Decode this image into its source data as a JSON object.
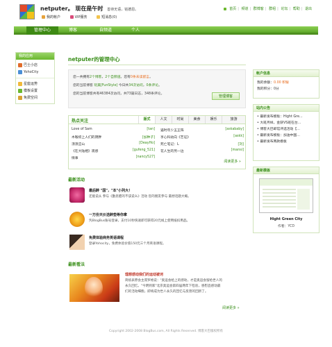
{
  "header": {
    "site_name": "netputer。",
    "status": "现在是午时",
    "slogan": "善待无语，铭德恩。",
    "user_links": [
      "我的帐户",
      "VIP服务",
      "短消息(0)"
    ],
    "top_nav": [
      "首页",
      "频道",
      "群博客",
      "群组",
      "论坛",
      "帮助",
      "退出"
    ]
  },
  "navbar": {
    "tabs": [
      "管理中心",
      "博客",
      "自频道",
      "个人"
    ]
  },
  "left": {
    "head": "我的应用",
    "group1": [
      "巴士小店",
      "YohoCity"
    ],
    "group2": [
      "星座运势",
      "模板设置",
      "免费空间"
    ]
  },
  "center": {
    "title": "netputer的管理中心",
    "stats": {
      "line1_a": "您一共拥有",
      "line1_b": "2个博客",
      "line1_c": "，",
      "line1_d": "2个自频道",
      "line1_e": "。您有",
      "line1_f": "0条未读留言",
      "line1_g": "。",
      "line2": "您的当前博客",
      "line2_blog": "玩美[FunStyle]",
      "line2_rest": "今日共",
      "line2_visits": "34次访问",
      "line2_end": "，",
      "line2_comments": "0条评论",
      "line2_tail": "。",
      "line3": "您的当前博客共有46384次访问，共73篇日志，348条评论。",
      "manage_btn": "管理博客"
    },
    "hot": {
      "title": "热点关注",
      "tabs": [
        "版式",
        "人文",
        "时尚",
        "美食",
        "娱乐",
        "旅游"
      ],
      "left_rows": [
        {
          "t": "Love of Sam",
          "a": "[tan]"
        },
        {
          "t": "木喉综上人们的阴胖",
          "a": "[加种子]"
        },
        {
          "t": "须须应山",
          "a": "[DeayHo]"
        },
        {
          "t": "《在大陆相》观感",
          "a": "[gufeng_521]"
        },
        {
          "t": "情事",
          "a": "[nancy527]"
        }
      ],
      "right_rows": [
        {
          "t": "逼时年少五正阵",
          "a": "[askababy]"
        },
        {
          "t": "享心科幼向《艺证》",
          "a": "[askk]"
        },
        {
          "t": "死亡笔记：L",
          "a": "[刘]"
        },
        {
          "t": "花人生的另一边",
          "a": "[mansi]"
        }
      ],
      "more": "阅读更多 »"
    },
    "activities_title": "最新活动",
    "activities": [
      {
        "title": "最后醉 \"国\"，\"本\"小列大！",
        "desc": "还能说从 参与《勤思肥的不该说么》活动  您的朋友参与 最想话题大概。"
      },
      {
        "title": "一万份天价选醉垫等你拿",
        "desc": "凭BlogBus账号登录，支付10秒快速即可获得20元线上使用抵扣用品。"
      },
      {
        "title": "免费体验商务英语课程",
        "desc": "登录Yohocity，免费体验价值150元三个月英语课程。"
      }
    ],
    "watch_title": "最新看法",
    "watch": {
      "title": "理想感动我们的运动被诃",
      "lines": [
        "简统表原会主席罗格说：\"奥运会给上的感动，才是奥运会留给世人的",
        "永久回忆。\"今明到家\"北京奥运会第四届两年下检验，感慰品感动最",
        "们的活动细胞，即将成为世人永久的回忆与反馈的回新了。"
      ],
      "more": "阅读更多 »"
    }
  },
  "right": {
    "account": {
      "head": "帐户信息",
      "bus_coin_label": "我的余额：",
      "bus_coin": "0.00 积银",
      "points": "我的积分：0分"
    },
    "notice": {
      "head": "站内公告",
      "items": [
        "最新发布模板：Hight Gre…",
        "大班月样，金获VS班在台…",
        "博客大巴邮馆评选活动【…",
        "最新发布模板：加油中国…",
        "最新发布两款模板"
      ]
    },
    "template": {
      "head": "最新模板",
      "name": "Hight Green City",
      "author": "作者：YCD"
    }
  },
  "footer": "Copyright 2002-2008 BlogBus.com, All Rights Reserved. 博客大巴版权所有"
}
